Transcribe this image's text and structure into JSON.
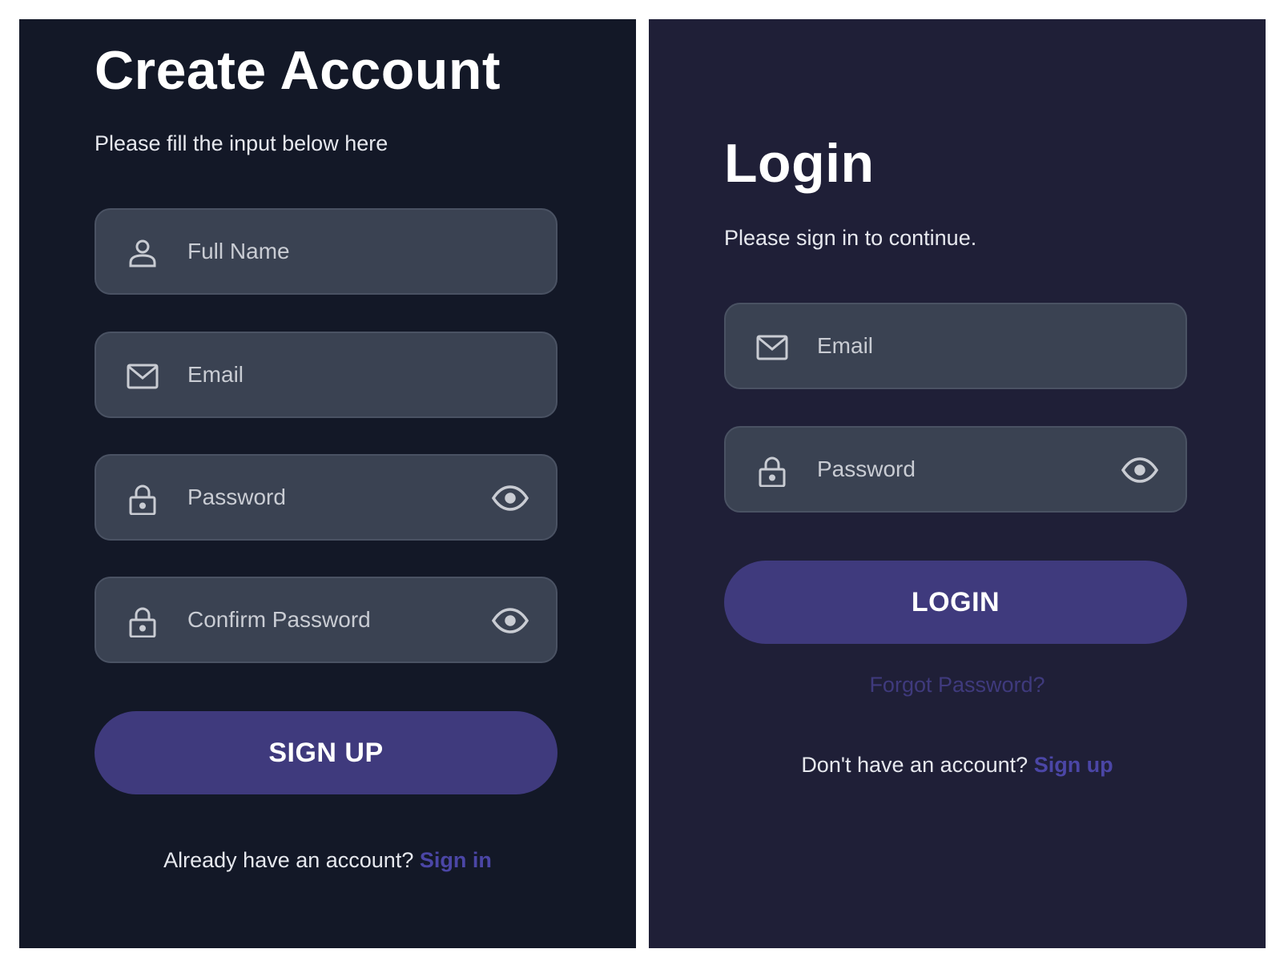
{
  "signup": {
    "title": "Create Account",
    "subtitle": "Please fill the input below here",
    "fields": [
      {
        "placeholder": "Full Name",
        "icon": "person-icon"
      },
      {
        "placeholder": "Email",
        "icon": "mail-icon"
      },
      {
        "placeholder": "Password",
        "icon": "lock-icon",
        "toggle_icon": "eye-icon"
      },
      {
        "placeholder": "Confirm Password",
        "icon": "lock-icon",
        "toggle_icon": "eye-icon"
      }
    ],
    "button_label": "SIGN UP",
    "footer_text": "Already have an account?",
    "footer_link": "Sign in"
  },
  "login": {
    "title": "Login",
    "subtitle": "Please sign in to continue.",
    "fields": [
      {
        "placeholder": "Email",
        "icon": "mail-icon"
      },
      {
        "placeholder": "Password",
        "icon": "lock-icon",
        "toggle_icon": "eye-icon"
      }
    ],
    "button_label": "LOGIN",
    "forgot_link": "Forgot Password?",
    "footer_text": "Don't have an account?",
    "footer_link": "Sign up"
  },
  "colors": {
    "signup_bg": "#131827",
    "login_bg": "#1f1f37",
    "field_bg": "#3a4252",
    "button_bg": "#3f3a7d",
    "link": "#4b46a6"
  }
}
